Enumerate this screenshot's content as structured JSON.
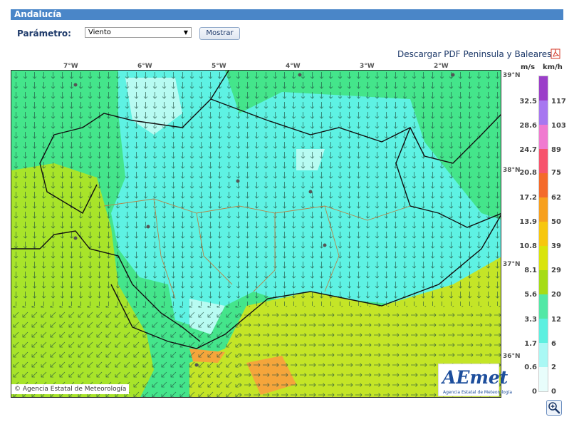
{
  "header": {
    "title": "Andalucía"
  },
  "form": {
    "param_label": "Parámetro:",
    "select_value": "Viento",
    "submit_label": "Mostrar"
  },
  "download": {
    "label": "Descargar PDF Peninsula y Baleares",
    "icon": "pdf-icon"
  },
  "map": {
    "longitudes": [
      "7°W",
      "6°W",
      "5°W",
      "4°W",
      "3°W",
      "2°W"
    ],
    "latitudes": [
      "39°N",
      "38°N",
      "37°N",
      "36°N"
    ],
    "copyright": "© Agencia Estatal de Meteorología",
    "logo_text": "AEmet",
    "logo_subtext": "Agencia Estatal de Meteorología"
  },
  "legend": {
    "unit_ms": "m/s",
    "unit_kmh": "km/h",
    "ticks_ms": [
      "32.5",
      "28.6",
      "24.7",
      "20.8",
      "17.2",
      "13.9",
      "10.8",
      "8.1",
      "5.6",
      "3.3",
      "1.7",
      "0.6",
      "0"
    ],
    "ticks_kmh": [
      "117",
      "103",
      "89",
      "75",
      "62",
      "50",
      "39",
      "29",
      "20",
      "12",
      "6",
      "2",
      "0"
    ],
    "colors": [
      "#9b3fc9",
      "#a777f0",
      "#f07ad0",
      "#f7546d",
      "#f7686a",
      "#f46a2a",
      "#f7a01e",
      "#f7c70e",
      "#d9e40b",
      "#a6dc16",
      "#7de044",
      "#52e8a6",
      "#5df0e0",
      "#cdfafa"
    ]
  },
  "colors": {
    "title_bg": "#4a86c8",
    "land_cyan": "#5ef2e3",
    "land_green": "#44e58b",
    "land_yellow": "#b8e322",
    "hot_orange": "#f5a53b"
  },
  "zoom": {
    "icon": "zoom-in-icon"
  }
}
